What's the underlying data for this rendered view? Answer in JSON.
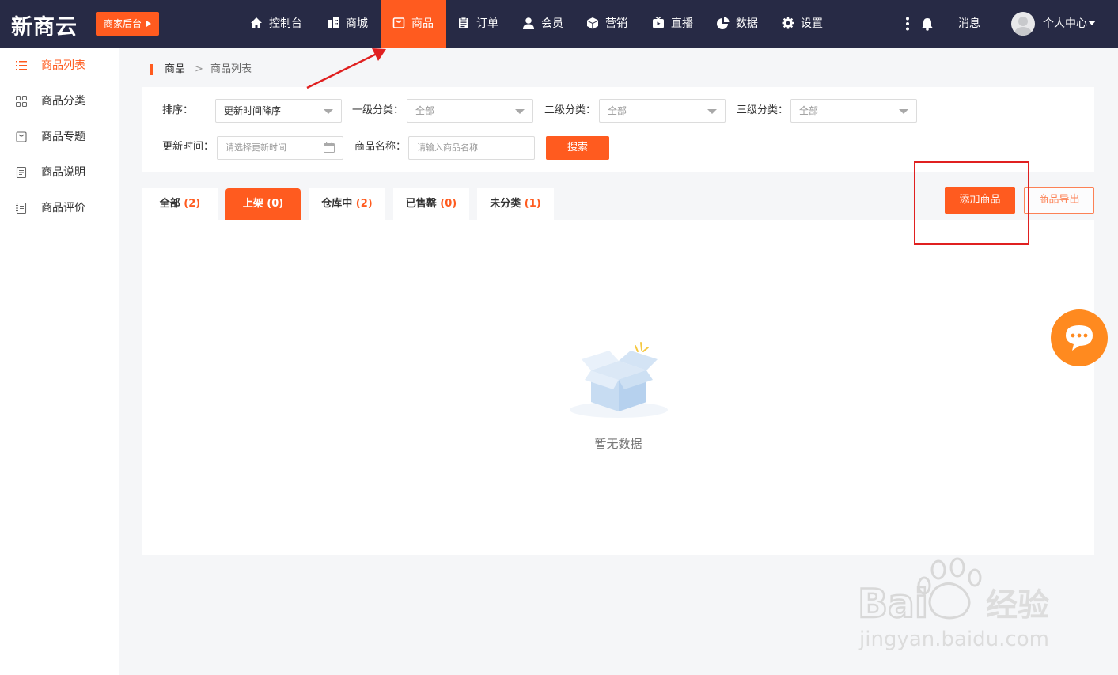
{
  "brand": {
    "logo": "新商云",
    "merchant_label": "商家后台"
  },
  "nav": {
    "items": [
      {
        "label": "控制台",
        "icon": "home-icon"
      },
      {
        "label": "商城",
        "icon": "building-icon"
      },
      {
        "label": "商品",
        "icon": "bag-icon",
        "active": true
      },
      {
        "label": "订单",
        "icon": "clipboard-icon"
      },
      {
        "label": "会员",
        "icon": "user-icon"
      },
      {
        "label": "营销",
        "icon": "cube-icon"
      },
      {
        "label": "直播",
        "icon": "tv-icon"
      },
      {
        "label": "数据",
        "icon": "pie-chart-icon"
      },
      {
        "label": "设置",
        "icon": "gear-icon"
      }
    ],
    "messages_label": "消息",
    "profile_label": "个人中心"
  },
  "sidebar": {
    "items": [
      {
        "label": "商品列表",
        "icon": "list-icon",
        "active": true
      },
      {
        "label": "商品分类",
        "icon": "grid-icon"
      },
      {
        "label": "商品专题",
        "icon": "bag-outline-icon"
      },
      {
        "label": "商品说明",
        "icon": "document-icon"
      },
      {
        "label": "商品评价",
        "icon": "review-icon"
      }
    ]
  },
  "breadcrumb": {
    "root": "商品",
    "separator": ">",
    "current": "商品列表"
  },
  "filters": {
    "sort_label": "排序：",
    "sort_value": "更新时间降序",
    "cat1_label": "一级分类：",
    "cat1_value": "全部",
    "cat2_label": "二级分类：",
    "cat2_value": "全部",
    "cat3_label": "三级分类：",
    "cat3_value": "全部",
    "time_label": "更新时间：",
    "time_placeholder": "请选择更新时间",
    "name_label": "商品名称：",
    "name_placeholder": "请输入商品名称",
    "search_label": "搜索"
  },
  "tabs": [
    {
      "label": "全部",
      "count": "(2)"
    },
    {
      "label": "上架",
      "count": "(0)",
      "active": true
    },
    {
      "label": "仓库中",
      "count": "(2)"
    },
    {
      "label": "已售罄",
      "count": "(0)"
    },
    {
      "label": "未分类",
      "count": "(1)"
    }
  ],
  "actions": {
    "add_label": "添加商品",
    "export_label": "商品导出"
  },
  "empty": {
    "text": "暂无数据"
  },
  "colors": {
    "accent": "#ff5b1f",
    "topbar": "#272a45",
    "annotation": "#e02020"
  }
}
